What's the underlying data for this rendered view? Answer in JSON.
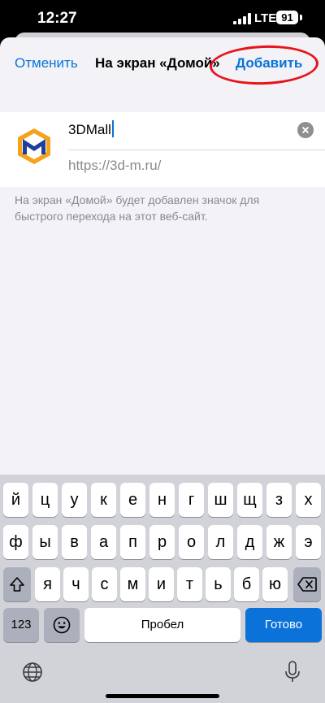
{
  "status": {
    "time": "12:27",
    "network": "LTE",
    "battery": "91"
  },
  "nav": {
    "cancel_label": "Отменить",
    "title": "На экран «Домой»",
    "add_label": "Добавить"
  },
  "card": {
    "name_value": "3DMall",
    "url": "https://3d-m.ru/"
  },
  "hint": "На экран «Домой» будет добавлен значок для быстрого перехода на этот веб-сайт.",
  "keyboard": {
    "row1": [
      "й",
      "ц",
      "у",
      "к",
      "е",
      "н",
      "г",
      "ш",
      "щ",
      "з",
      "х"
    ],
    "row2": [
      "ф",
      "ы",
      "в",
      "а",
      "п",
      "р",
      "о",
      "л",
      "д",
      "ж",
      "э"
    ],
    "row3": [
      "я",
      "ч",
      "с",
      "м",
      "и",
      "т",
      "ь",
      "б",
      "ю"
    ],
    "numbers_label": "123",
    "space_label": "Пробел",
    "done_label": "Готово"
  },
  "colors": {
    "accent": "#0a72d9",
    "annotation": "#e8141c",
    "logo_blue": "#1f3f9b",
    "logo_orange": "#f5a31c"
  }
}
